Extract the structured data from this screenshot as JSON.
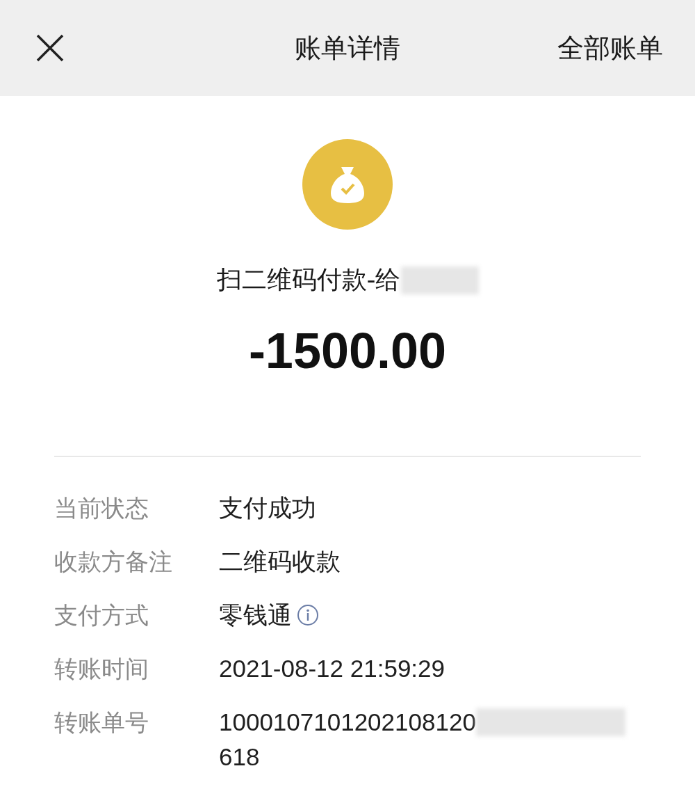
{
  "header": {
    "title": "账单详情",
    "action": "全部账单"
  },
  "summary": {
    "title": "扫二维码付款-给",
    "redacted": true,
    "amount": "-1500.00"
  },
  "details": [
    {
      "label": "当前状态",
      "value": "支付成功",
      "info": false,
      "redacted": false
    },
    {
      "label": "收款方备注",
      "value": "二维码收款",
      "info": false,
      "redacted": false
    },
    {
      "label": "支付方式",
      "value": "零钱通",
      "info": true,
      "redacted": false
    },
    {
      "label": "转账时间",
      "value": "2021-08-12 21:59:29",
      "info": false,
      "redacted": false
    },
    {
      "label": "转账单号",
      "value": "1000107101202108120",
      "info": false,
      "redacted": true,
      "value_2": "618"
    }
  ]
}
